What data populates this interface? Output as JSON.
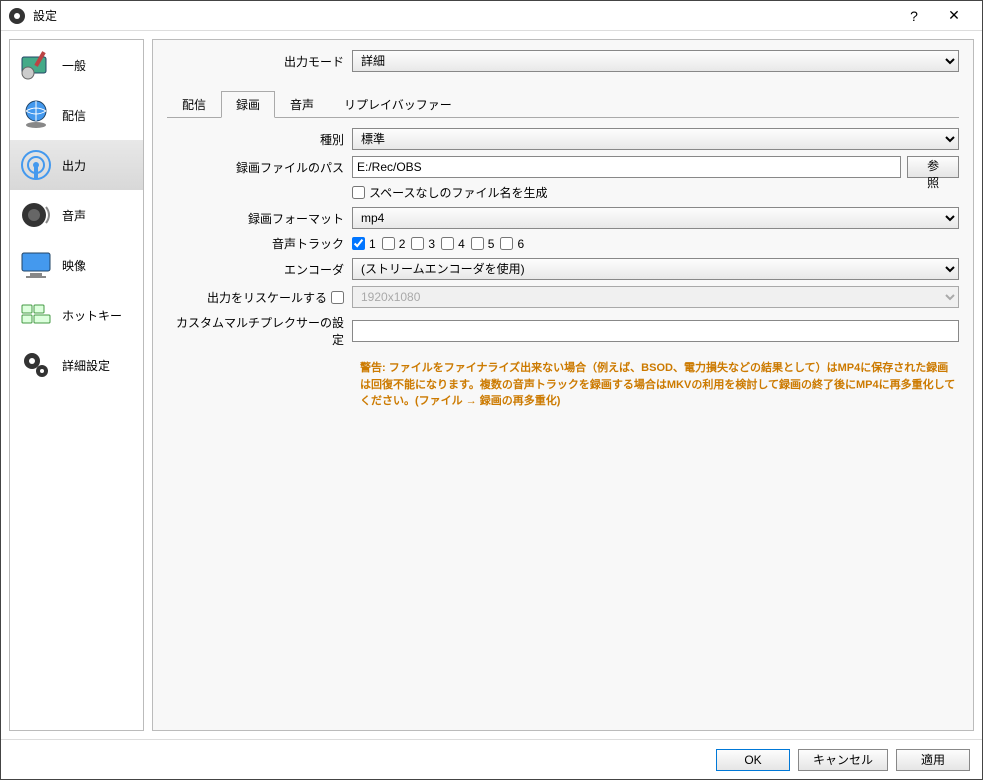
{
  "window": {
    "title": "設定"
  },
  "sidebar": {
    "items": [
      {
        "label": "一般"
      },
      {
        "label": "配信"
      },
      {
        "label": "出力"
      },
      {
        "label": "音声"
      },
      {
        "label": "映像"
      },
      {
        "label": "ホットキー"
      },
      {
        "label": "詳細設定"
      }
    ],
    "selected": 2
  },
  "outputMode": {
    "label": "出力モード",
    "value": "詳細"
  },
  "tabs": {
    "items": [
      "配信",
      "録画",
      "音声",
      "リプレイバッファー"
    ],
    "active": 1
  },
  "recording": {
    "type_label": "種別",
    "type_value": "標準",
    "path_label": "録画ファイルのパス",
    "path_value": "E:/Rec/OBS",
    "browse": "参照",
    "nospace_label": "スペースなしのファイル名を生成",
    "nospace_checked": false,
    "format_label": "録画フォーマット",
    "format_value": "mp4",
    "tracks_label": "音声トラック",
    "tracks": [
      {
        "label": "1",
        "checked": true
      },
      {
        "label": "2",
        "checked": false
      },
      {
        "label": "3",
        "checked": false
      },
      {
        "label": "4",
        "checked": false
      },
      {
        "label": "5",
        "checked": false
      },
      {
        "label": "6",
        "checked": false
      }
    ],
    "encoder_label": "エンコーダ",
    "encoder_value": "(ストリームエンコーダを使用)",
    "rescale_label": "出力をリスケールする",
    "rescale_checked": false,
    "rescale_value": "1920x1080",
    "mux_label": "カスタムマルチプレクサーの設定",
    "mux_value": "",
    "warning": "警告: ファイルをファイナライズ出来ない場合（例えば、BSOD、電力損失などの結果として）はMP4に保存された録画は回復不能になります。複数の音声トラックを録画する場合はMKVの利用を検討して録画の終了後にMP4に再多重化してください。(ファイル → 録画の再多重化)"
  },
  "footer": {
    "ok": "OK",
    "cancel": "キャンセル",
    "apply": "適用"
  }
}
